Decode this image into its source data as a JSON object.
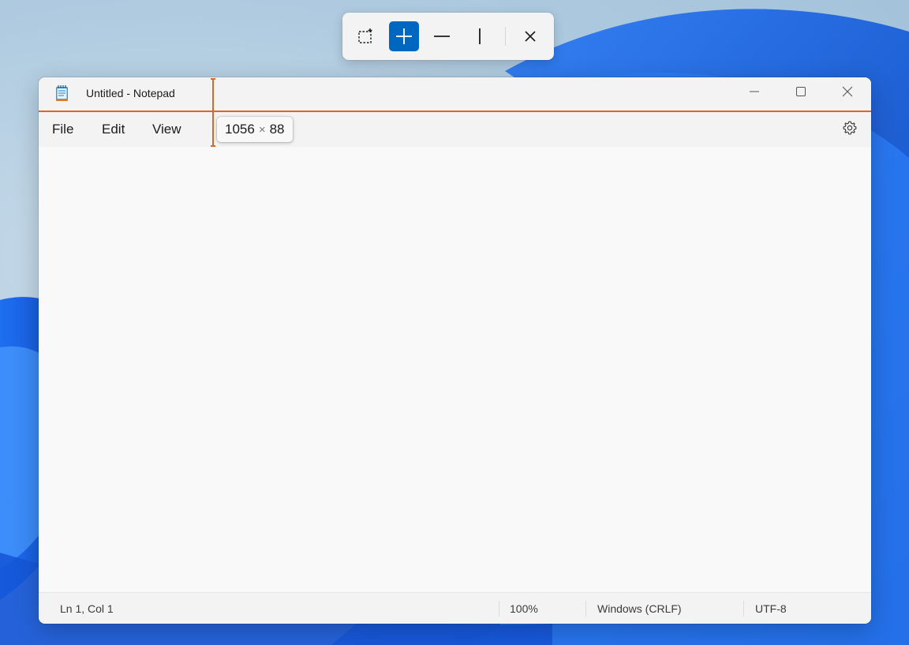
{
  "measure_toolbar": {
    "tools": [
      {
        "name": "bounds",
        "icon": "selection-bounds-icon"
      },
      {
        "name": "spacing",
        "icon": "crosshair-icon",
        "active": true
      },
      {
        "name": "horizontal",
        "icon": "horizontal-line-icon"
      },
      {
        "name": "vertical",
        "icon": "vertical-line-icon"
      },
      {
        "name": "close",
        "icon": "close-icon"
      }
    ],
    "accent": "#0067c0"
  },
  "window": {
    "title": "Untitled - Notepad",
    "app_icon": "notepad-icon",
    "menu": [
      "File",
      "Edit",
      "View"
    ],
    "settings_icon": "gear-icon",
    "editor_text": "",
    "status": {
      "position": "Ln 1, Col 1",
      "zoom": "100%",
      "line_ending": "Windows (CRLF)",
      "encoding": "UTF-8"
    }
  },
  "measurement": {
    "width": "1056",
    "separator": "×",
    "height": "88",
    "line_color": "#e0661f"
  }
}
